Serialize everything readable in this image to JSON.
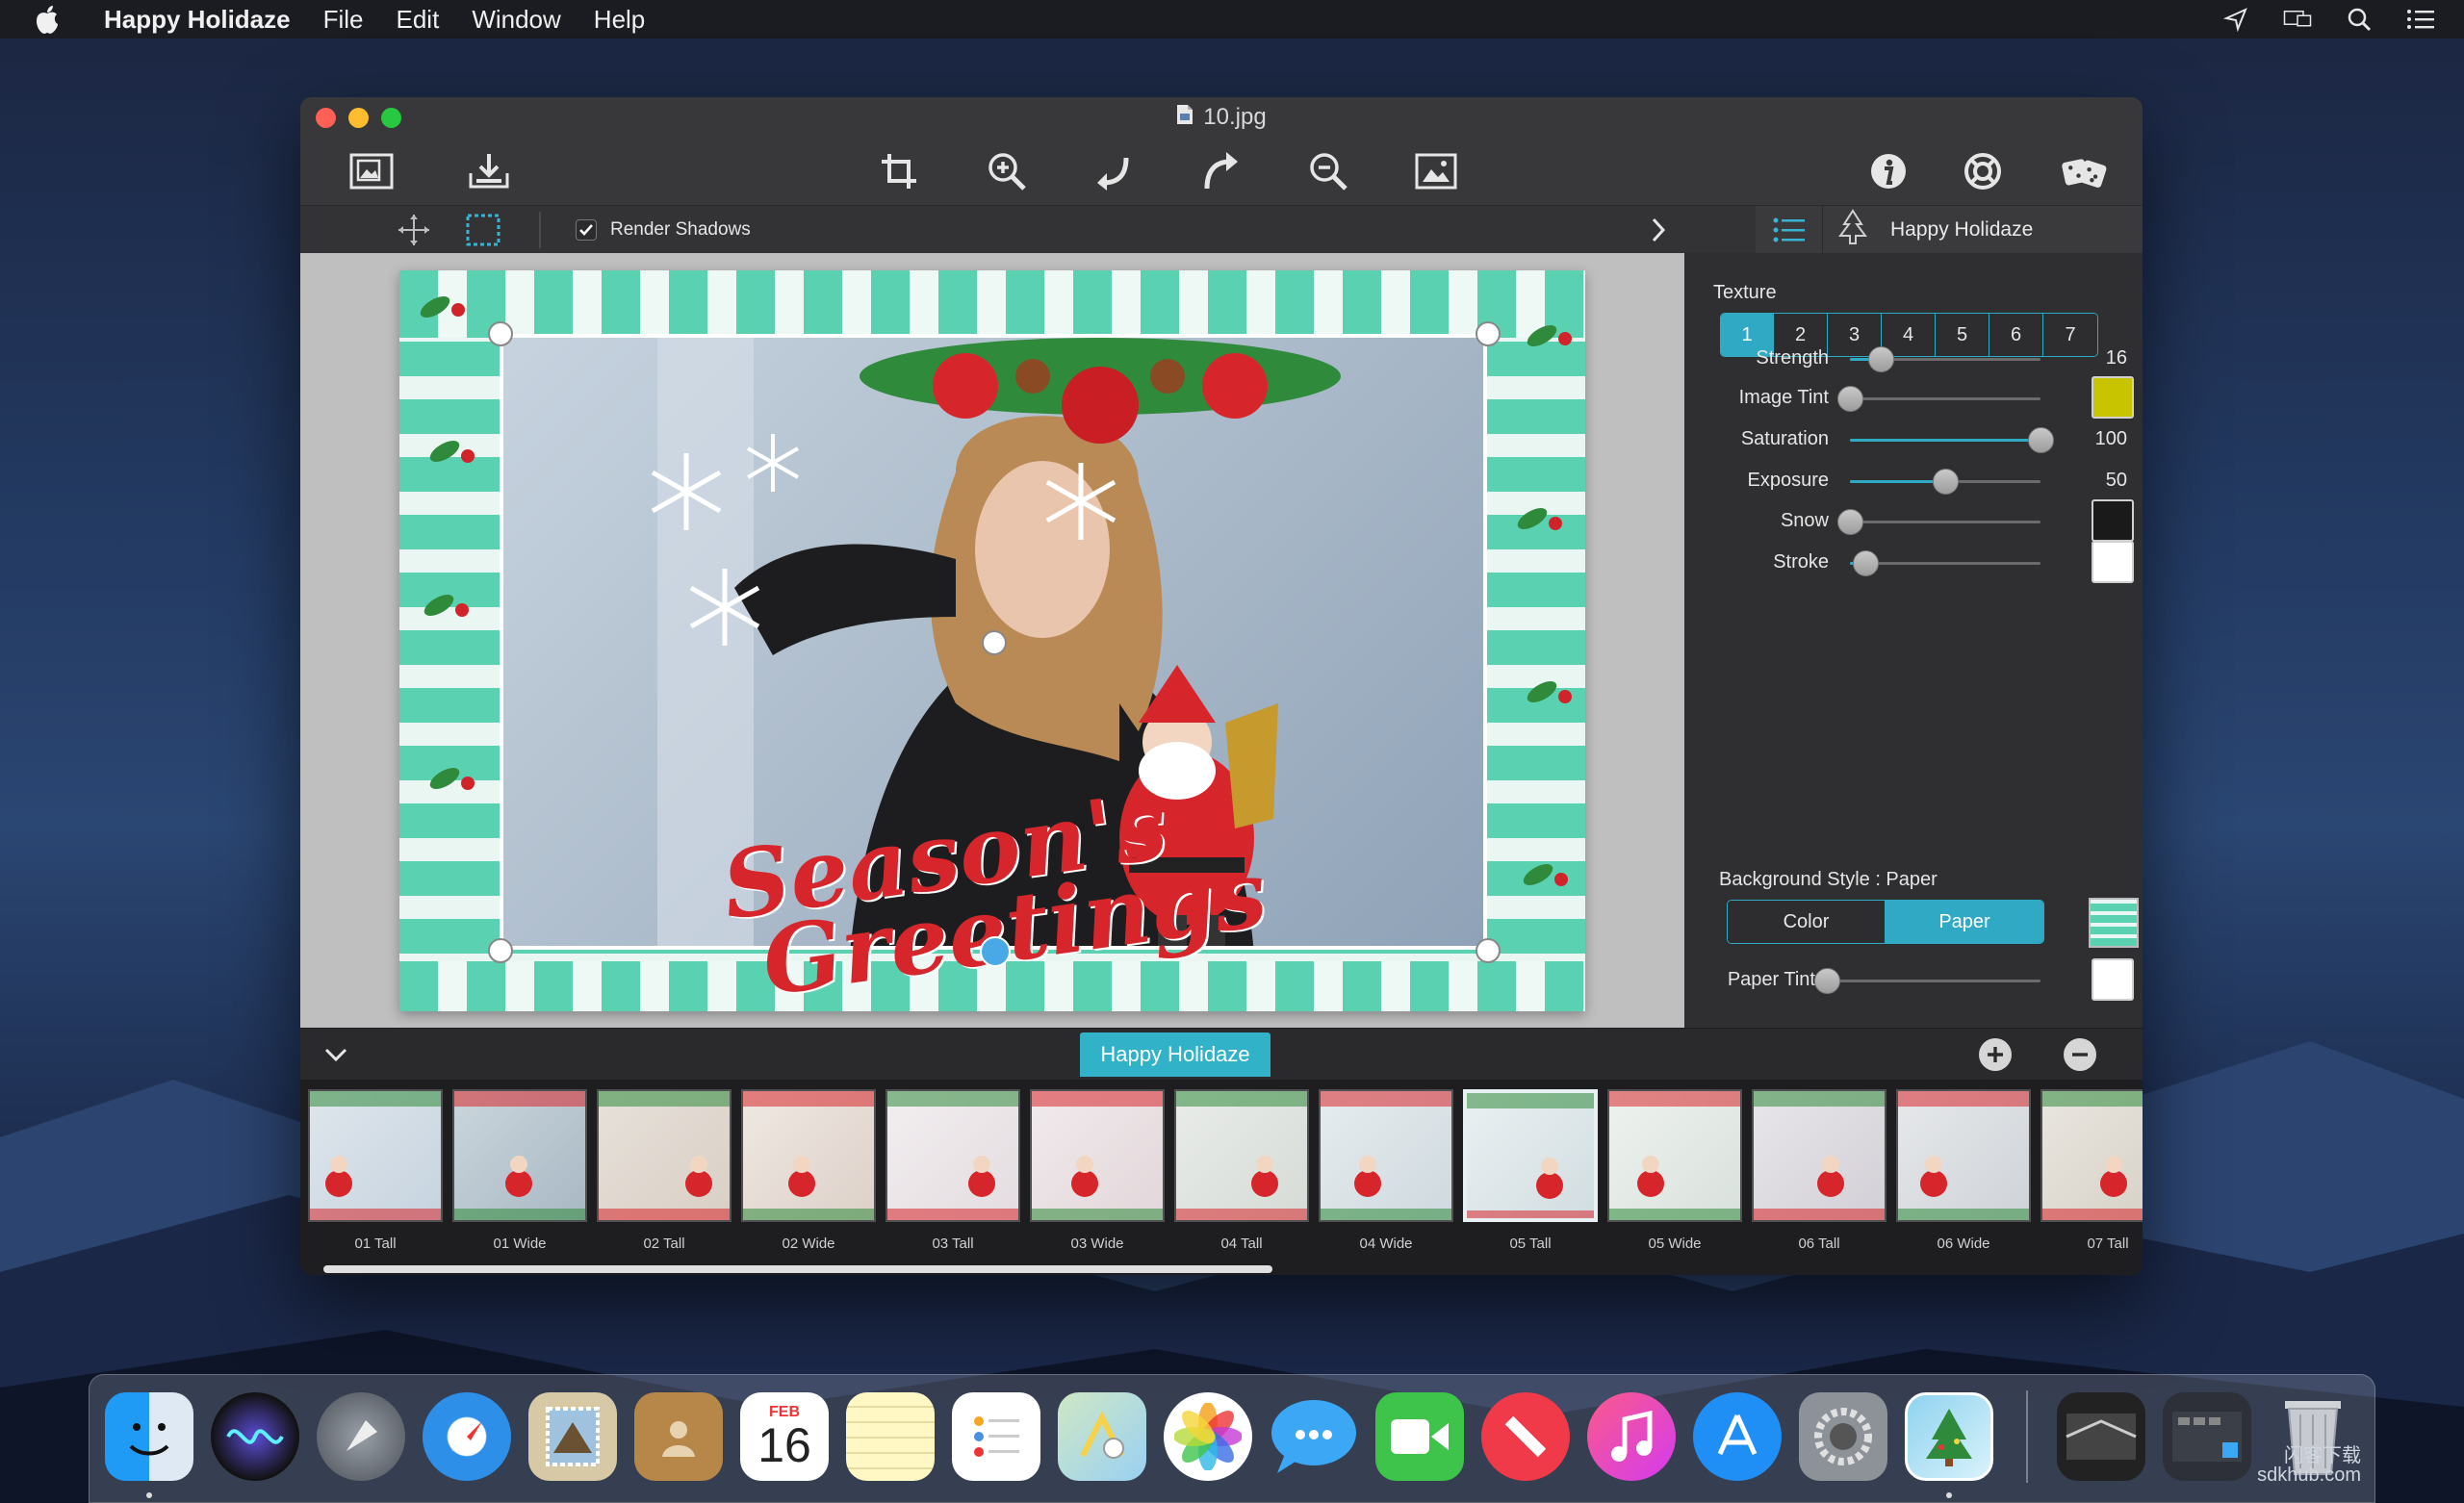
{
  "menubar": {
    "app_name": "Happy Holidaze",
    "items": [
      "File",
      "Edit",
      "Window",
      "Help"
    ]
  },
  "window": {
    "title": "10.jpg"
  },
  "subbar": {
    "render_shadows_label": "Render Shadows",
    "render_shadows_checked": true,
    "panel_title": "Happy Holidaze"
  },
  "card": {
    "greeting_line1": "Season's",
    "greeting_line2": "Greetings"
  },
  "panel": {
    "texture_heading": "Texture",
    "texture_options": [
      "1",
      "2",
      "3",
      "4",
      "5",
      "6",
      "7"
    ],
    "texture_selected": "1",
    "sliders": [
      {
        "label": "Strength",
        "value": "16",
        "fraction": 0.16
      },
      {
        "label": "Image Tint",
        "value": "",
        "fraction": 0.0,
        "swatch": "#c9c400"
      },
      {
        "label": "Saturation",
        "value": "100",
        "fraction": 1.0
      },
      {
        "label": "Exposure",
        "value": "50",
        "fraction": 0.5
      },
      {
        "label": "Snow",
        "value": "",
        "fraction": 0.0,
        "swatch": "#1a1a1a"
      },
      {
        "label": "Stroke",
        "value": "",
        "fraction": 0.08,
        "swatch": "#ffffff"
      }
    ],
    "background_heading": "Background Style : Paper",
    "background_options": [
      "Color",
      "Paper"
    ],
    "background_selected": "Paper",
    "paper_tint_label": "Paper Tint",
    "paper_tint_fraction": 0.0,
    "paper_tint_swatch": "#ffffff"
  },
  "filmstrip": {
    "tab_label": "Happy Holidaze",
    "thumbs": [
      "01 Tall",
      "01 Wide",
      "02 Tall",
      "02 Wide",
      "03 Tall",
      "03 Wide",
      "04 Tall",
      "04 Wide",
      "05 Tall",
      "05 Wide",
      "06 Tall",
      "06 Wide",
      "07 Tall"
    ],
    "selected": "05 Tall"
  },
  "dock": {
    "calendar_month": "FEB",
    "calendar_day": "16",
    "watermark_line1": "闪客下载",
    "watermark_line2": "sdkhub.com"
  },
  "colors": {
    "accent": "#30a9c4",
    "card_mint": "#5ad1b0",
    "greeting_red": "#d7262b"
  }
}
